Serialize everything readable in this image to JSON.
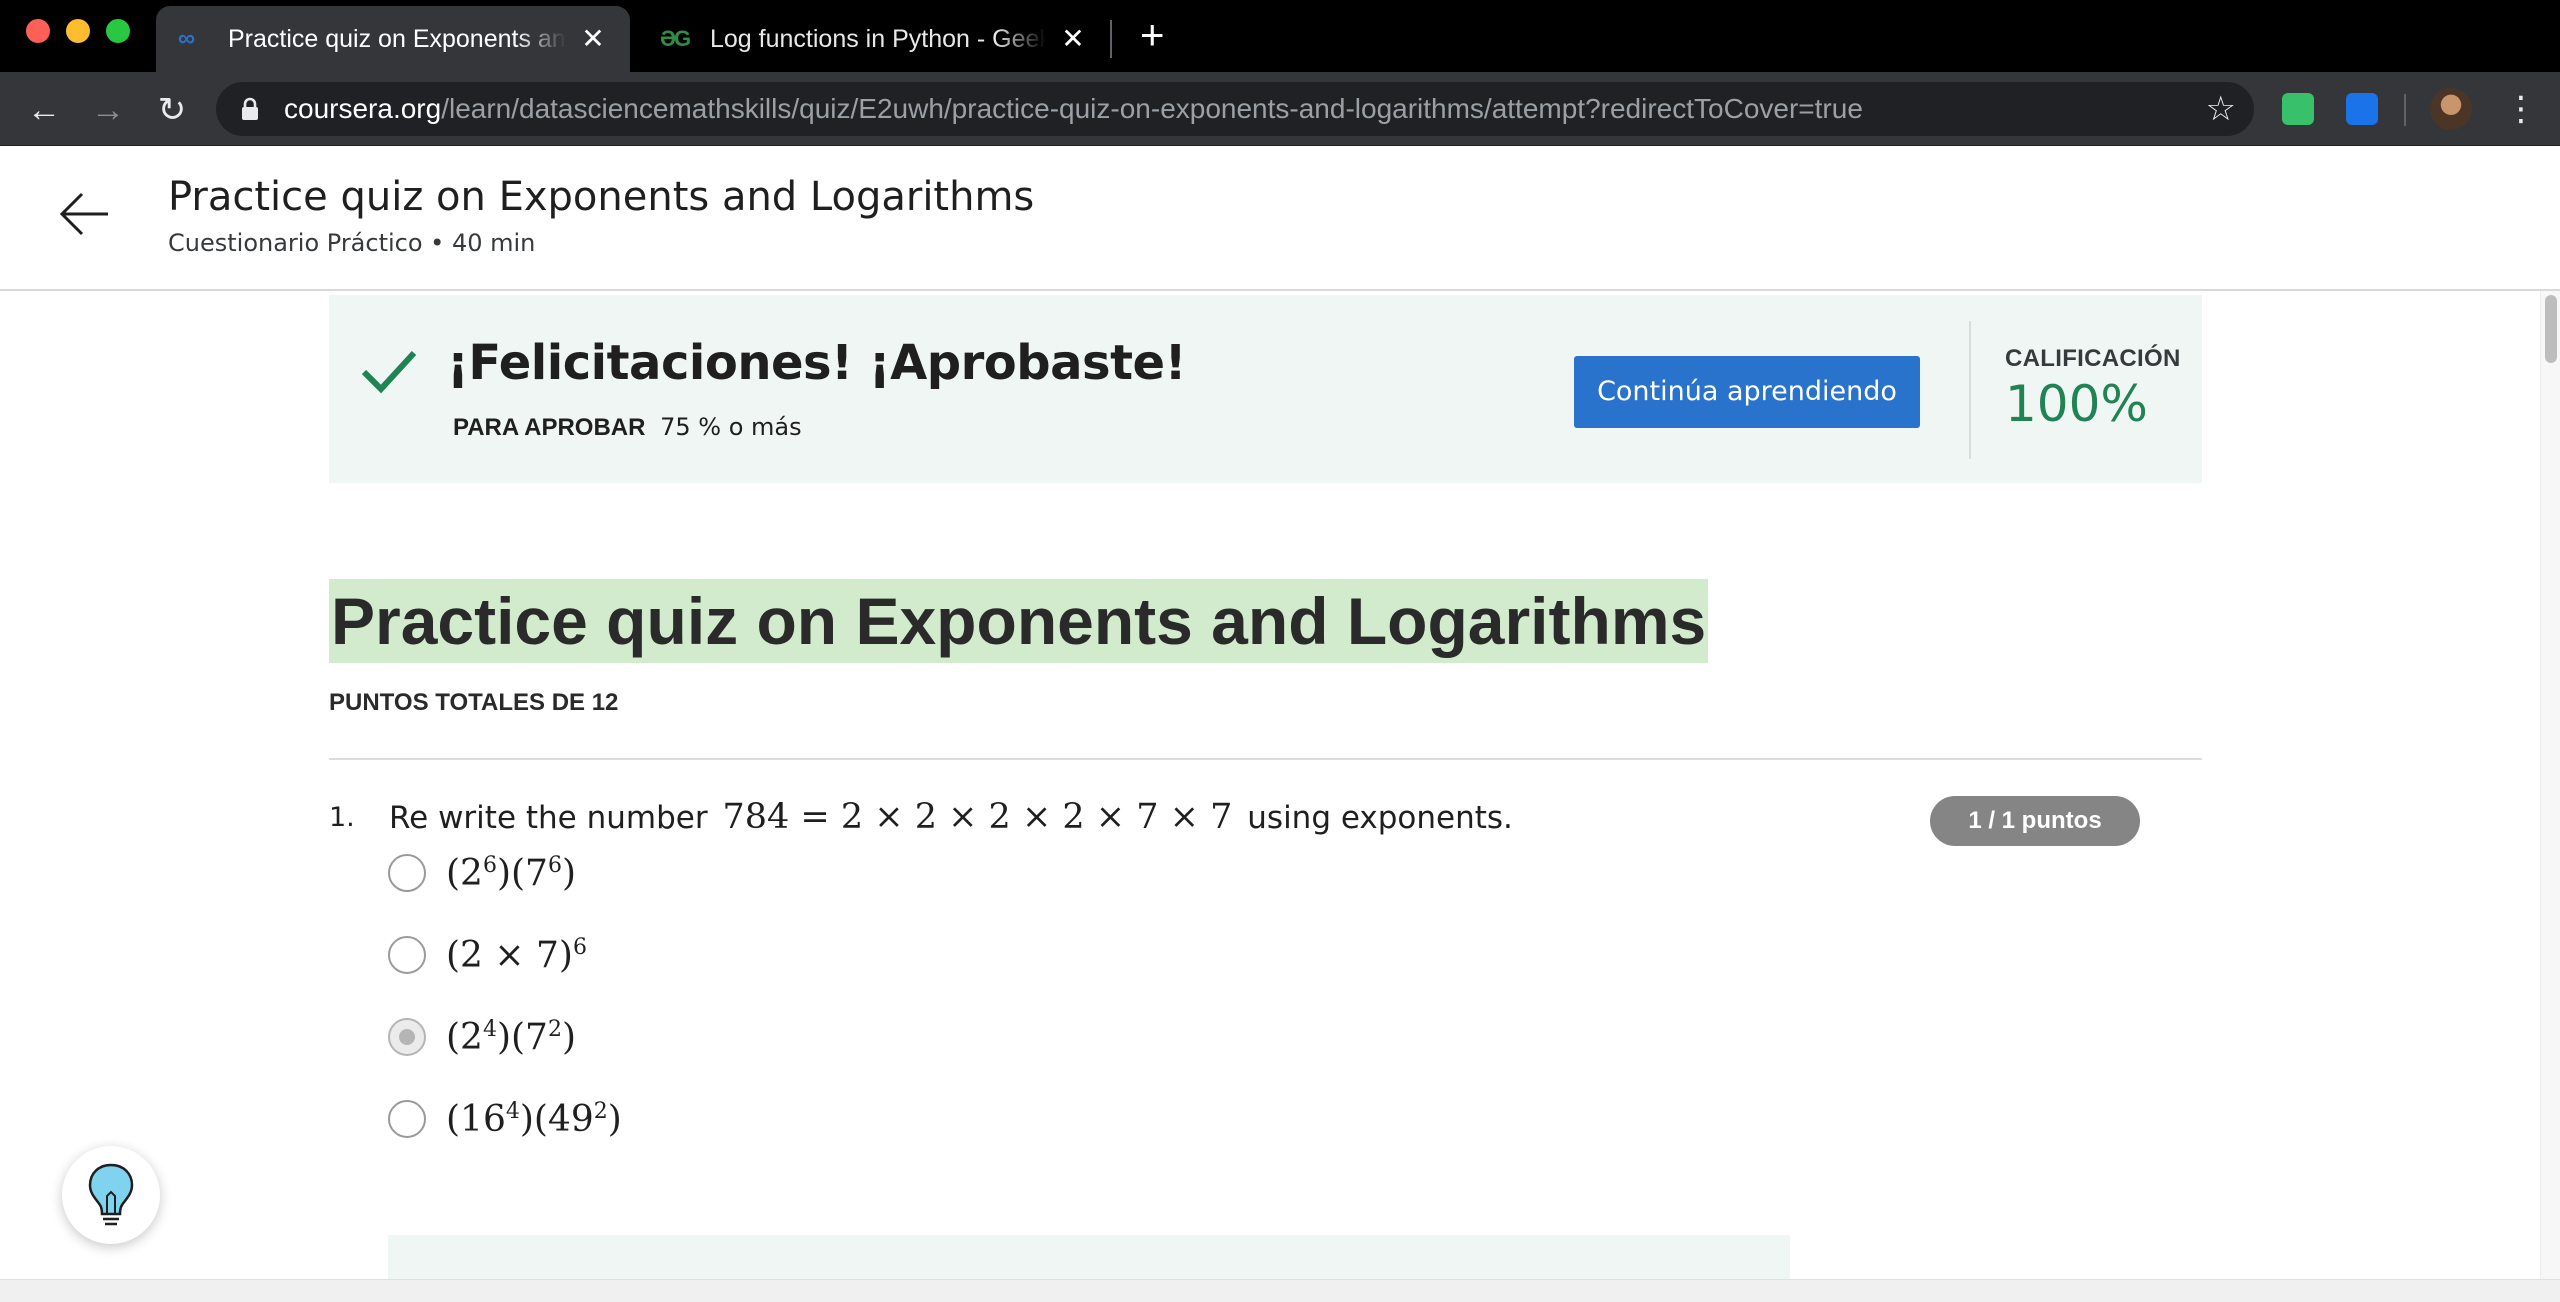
{
  "browser": {
    "tabs": [
      {
        "title": "Practice quiz on Exponents and Logarithms | Coursera",
        "icon": "coursera-icon",
        "active": true
      },
      {
        "title": "Log functions in Python - GeeksforGeeks",
        "icon": "geeksforgeeks-icon",
        "active": false
      }
    ],
    "url_host": "coursera.org",
    "url_path": "/learn/datasciencemathskills/quiz/E2uwh/practice-quiz-on-exponents-and-logarithms/attempt?redirectToCover=true"
  },
  "header": {
    "title": "Practice quiz on Exponents and Logarithms",
    "subtitle": "Cuestionario Práctico • 40 min"
  },
  "result": {
    "message": "¡Felicitaciones! ¡Aprobaste!",
    "pass_label": "PARA APROBAR",
    "pass_value": "75 % o más",
    "continue_button": "Continúa aprendiendo",
    "grade_label": "CALIFICACIÓN",
    "grade_value": "100%",
    "accent": "#1f8354",
    "button_color": "#2a73cc"
  },
  "quiz": {
    "title": "Practice quiz on Exponents and Logarithms",
    "total_points": "PUNTOS TOTALES DE 12",
    "questions": [
      {
        "number": "1.",
        "text_before": "Re write the number",
        "math": "784 = 2 × 2 × 2 × 2 × 7 × 7",
        "text_after": "using exponents.",
        "points": "1 / 1 puntos",
        "selected_index": 2,
        "options": [
          {
            "id": "a",
            "text": "(2^6)(7^6)"
          },
          {
            "id": "b",
            "text": "(2 × 7)^6"
          },
          {
            "id": "c",
            "text": "(2^4)(7^2)"
          },
          {
            "id": "d",
            "text": "(16^4)(49^2)"
          }
        ]
      }
    ]
  }
}
